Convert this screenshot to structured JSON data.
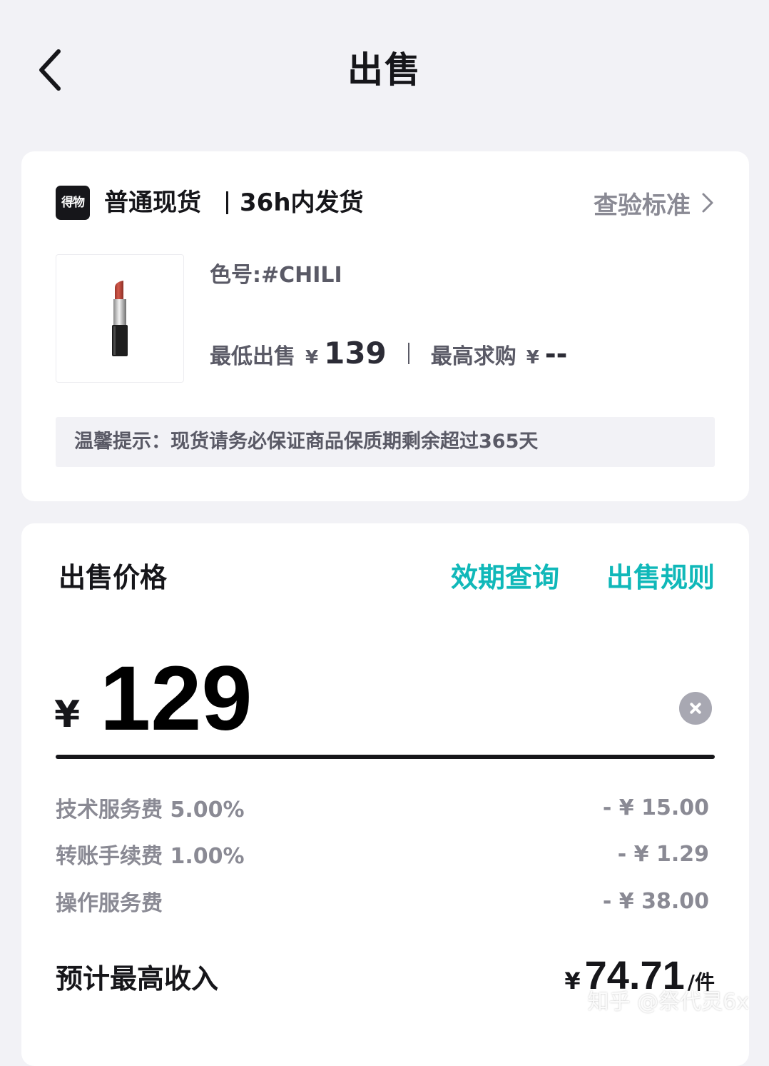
{
  "header": {
    "title": "出售"
  },
  "product_card": {
    "logo_text": "得物",
    "shipping_type": "普通现货",
    "shipping_time": "36h内发货",
    "inspect_label": "查验标准",
    "color_code": "色号:#CHILI",
    "lowest_sell_label": "最低出售",
    "lowest_sell_currency": "¥",
    "lowest_sell_price": "139",
    "highest_bid_label": "最高求购",
    "highest_bid_currency": "¥",
    "highest_bid_price": "--",
    "tip": "温馨提示：现货请务必保证商品保质期剩余超过365天"
  },
  "price_card": {
    "title": "出售价格",
    "validity_link": "效期查询",
    "rules_link": "出售规则",
    "currency": "¥",
    "price_value": "129",
    "fees": [
      {
        "label": "技术服务费 5.00%",
        "amount": "- ¥ 15.00"
      },
      {
        "label": "转账手续费 1.00%",
        "amount": "- ¥ 1.29"
      },
      {
        "label": "操作服务费",
        "amount": "- ¥ 38.00"
      }
    ],
    "income_label": "预计最高收入",
    "income_currency": "¥",
    "income_value": "74.71",
    "income_unit": "/件"
  },
  "watermark": "知乎 @祭代灵6x",
  "colors": {
    "accent": "#10b8b9",
    "text_primary": "#16161a",
    "text_secondary": "#8a8a94",
    "background": "#f2f2f6",
    "lipstick": "#c0473a"
  }
}
